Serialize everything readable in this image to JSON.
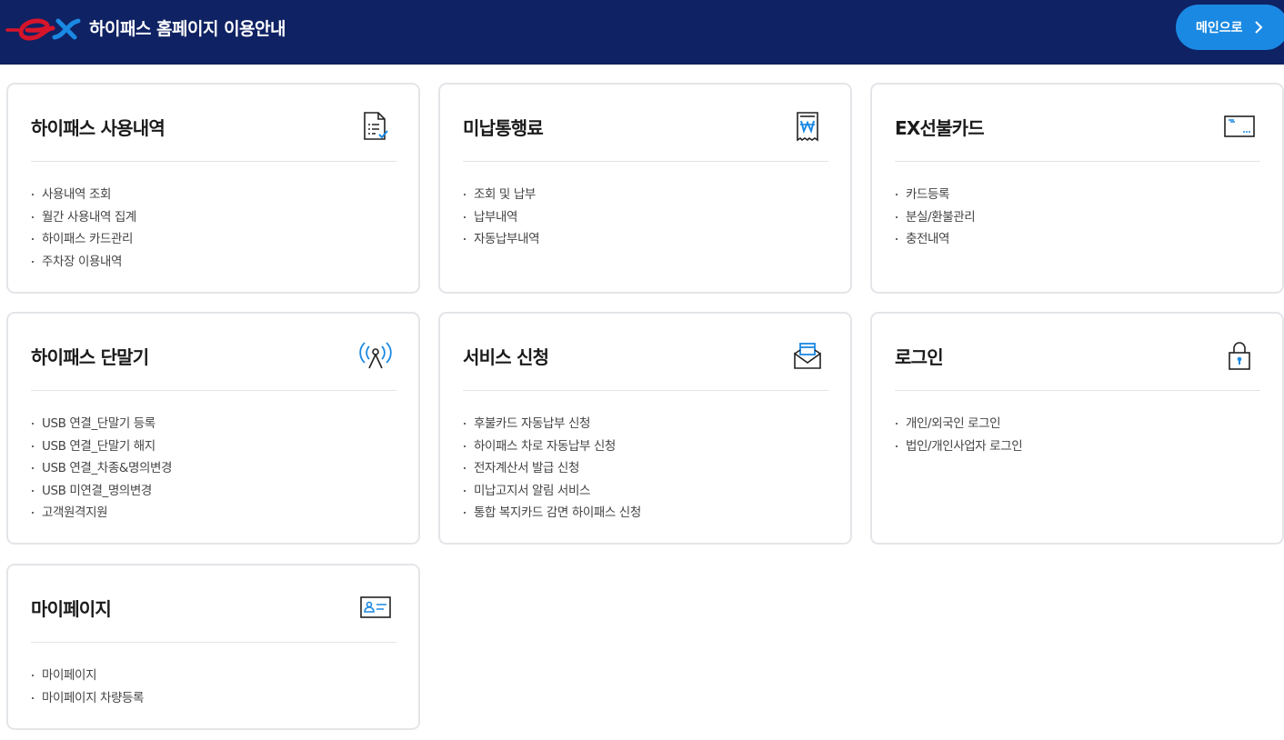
{
  "header": {
    "title": "하이패스 홈페이지 이용안내",
    "main_button": "메인으로",
    "logo_icon": "ex-logo-icon",
    "colors": {
      "background": "#0f2263",
      "button": "#1a89e3",
      "logo_red": "#d7152a",
      "logo_blue": "#1a89e3"
    }
  },
  "cards": [
    {
      "title": "하이패스 사용내역",
      "icon": "document-check-icon",
      "items": [
        "사용내역 조회",
        "월간 사용내역 집계",
        "하이패스 카드관리",
        "주차장 이용내역"
      ]
    },
    {
      "title": "미납통행료",
      "icon": "won-receipt-icon",
      "items": [
        "조회 및 납부",
        "납부내역",
        "자동납부내역"
      ]
    },
    {
      "title": "EX선불카드",
      "icon": "ex-card-icon",
      "items": [
        "카드등록",
        "분실/환불관리",
        "충전내역"
      ]
    },
    {
      "title": "하이패스 단말기",
      "icon": "antenna-signal-icon",
      "items": [
        "USB 연결_단말기 등록",
        "USB 연결_단말기 해지",
        "USB 연결_차종&명의변경",
        "USB 미연결_명의변경",
        "고객원격지원"
      ]
    },
    {
      "title": "서비스 신청",
      "icon": "envelope-icon",
      "items": [
        "후불카드 자동납부 신청",
        "하이패스 차로 자동납부 신청",
        "전자계산서 발급 신청",
        "미납고지서 알림 서비스",
        "통합 복지카드 감면 하이패스 신청"
      ]
    },
    {
      "title": "로그인",
      "icon": "lock-icon",
      "items": [
        "개인/외국인 로그인",
        "법인/개인사업자 로그인"
      ]
    },
    {
      "title": "마이페이지",
      "icon": "id-card-icon",
      "items": [
        "마이페이지",
        "마이페이지 차량등록"
      ]
    }
  ]
}
